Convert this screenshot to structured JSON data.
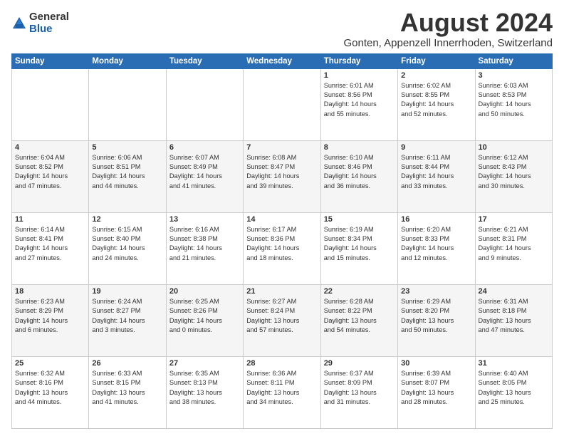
{
  "logo": {
    "general": "General",
    "blue": "Blue"
  },
  "title": "August 2024",
  "location": "Gonten, Appenzell Innerrhoden, Switzerland",
  "days_of_week": [
    "Sunday",
    "Monday",
    "Tuesday",
    "Wednesday",
    "Thursday",
    "Friday",
    "Saturday"
  ],
  "weeks": [
    [
      {
        "day": "",
        "info": ""
      },
      {
        "day": "",
        "info": ""
      },
      {
        "day": "",
        "info": ""
      },
      {
        "day": "",
        "info": ""
      },
      {
        "day": "1",
        "info": "Sunrise: 6:01 AM\nSunset: 8:56 PM\nDaylight: 14 hours\nand 55 minutes."
      },
      {
        "day": "2",
        "info": "Sunrise: 6:02 AM\nSunset: 8:55 PM\nDaylight: 14 hours\nand 52 minutes."
      },
      {
        "day": "3",
        "info": "Sunrise: 6:03 AM\nSunset: 8:53 PM\nDaylight: 14 hours\nand 50 minutes."
      }
    ],
    [
      {
        "day": "4",
        "info": "Sunrise: 6:04 AM\nSunset: 8:52 PM\nDaylight: 14 hours\nand 47 minutes."
      },
      {
        "day": "5",
        "info": "Sunrise: 6:06 AM\nSunset: 8:51 PM\nDaylight: 14 hours\nand 44 minutes."
      },
      {
        "day": "6",
        "info": "Sunrise: 6:07 AM\nSunset: 8:49 PM\nDaylight: 14 hours\nand 41 minutes."
      },
      {
        "day": "7",
        "info": "Sunrise: 6:08 AM\nSunset: 8:47 PM\nDaylight: 14 hours\nand 39 minutes."
      },
      {
        "day": "8",
        "info": "Sunrise: 6:10 AM\nSunset: 8:46 PM\nDaylight: 14 hours\nand 36 minutes."
      },
      {
        "day": "9",
        "info": "Sunrise: 6:11 AM\nSunset: 8:44 PM\nDaylight: 14 hours\nand 33 minutes."
      },
      {
        "day": "10",
        "info": "Sunrise: 6:12 AM\nSunset: 8:43 PM\nDaylight: 14 hours\nand 30 minutes."
      }
    ],
    [
      {
        "day": "11",
        "info": "Sunrise: 6:14 AM\nSunset: 8:41 PM\nDaylight: 14 hours\nand 27 minutes."
      },
      {
        "day": "12",
        "info": "Sunrise: 6:15 AM\nSunset: 8:40 PM\nDaylight: 14 hours\nand 24 minutes."
      },
      {
        "day": "13",
        "info": "Sunrise: 6:16 AM\nSunset: 8:38 PM\nDaylight: 14 hours\nand 21 minutes."
      },
      {
        "day": "14",
        "info": "Sunrise: 6:17 AM\nSunset: 8:36 PM\nDaylight: 14 hours\nand 18 minutes."
      },
      {
        "day": "15",
        "info": "Sunrise: 6:19 AM\nSunset: 8:34 PM\nDaylight: 14 hours\nand 15 minutes."
      },
      {
        "day": "16",
        "info": "Sunrise: 6:20 AM\nSunset: 8:33 PM\nDaylight: 14 hours\nand 12 minutes."
      },
      {
        "day": "17",
        "info": "Sunrise: 6:21 AM\nSunset: 8:31 PM\nDaylight: 14 hours\nand 9 minutes."
      }
    ],
    [
      {
        "day": "18",
        "info": "Sunrise: 6:23 AM\nSunset: 8:29 PM\nDaylight: 14 hours\nand 6 minutes."
      },
      {
        "day": "19",
        "info": "Sunrise: 6:24 AM\nSunset: 8:27 PM\nDaylight: 14 hours\nand 3 minutes."
      },
      {
        "day": "20",
        "info": "Sunrise: 6:25 AM\nSunset: 8:26 PM\nDaylight: 14 hours\nand 0 minutes."
      },
      {
        "day": "21",
        "info": "Sunrise: 6:27 AM\nSunset: 8:24 PM\nDaylight: 13 hours\nand 57 minutes."
      },
      {
        "day": "22",
        "info": "Sunrise: 6:28 AM\nSunset: 8:22 PM\nDaylight: 13 hours\nand 54 minutes."
      },
      {
        "day": "23",
        "info": "Sunrise: 6:29 AM\nSunset: 8:20 PM\nDaylight: 13 hours\nand 50 minutes."
      },
      {
        "day": "24",
        "info": "Sunrise: 6:31 AM\nSunset: 8:18 PM\nDaylight: 13 hours\nand 47 minutes."
      }
    ],
    [
      {
        "day": "25",
        "info": "Sunrise: 6:32 AM\nSunset: 8:16 PM\nDaylight: 13 hours\nand 44 minutes."
      },
      {
        "day": "26",
        "info": "Sunrise: 6:33 AM\nSunset: 8:15 PM\nDaylight: 13 hours\nand 41 minutes."
      },
      {
        "day": "27",
        "info": "Sunrise: 6:35 AM\nSunset: 8:13 PM\nDaylight: 13 hours\nand 38 minutes."
      },
      {
        "day": "28",
        "info": "Sunrise: 6:36 AM\nSunset: 8:11 PM\nDaylight: 13 hours\nand 34 minutes."
      },
      {
        "day": "29",
        "info": "Sunrise: 6:37 AM\nSunset: 8:09 PM\nDaylight: 13 hours\nand 31 minutes."
      },
      {
        "day": "30",
        "info": "Sunrise: 6:39 AM\nSunset: 8:07 PM\nDaylight: 13 hours\nand 28 minutes."
      },
      {
        "day": "31",
        "info": "Sunrise: 6:40 AM\nSunset: 8:05 PM\nDaylight: 13 hours\nand 25 minutes."
      }
    ]
  ]
}
